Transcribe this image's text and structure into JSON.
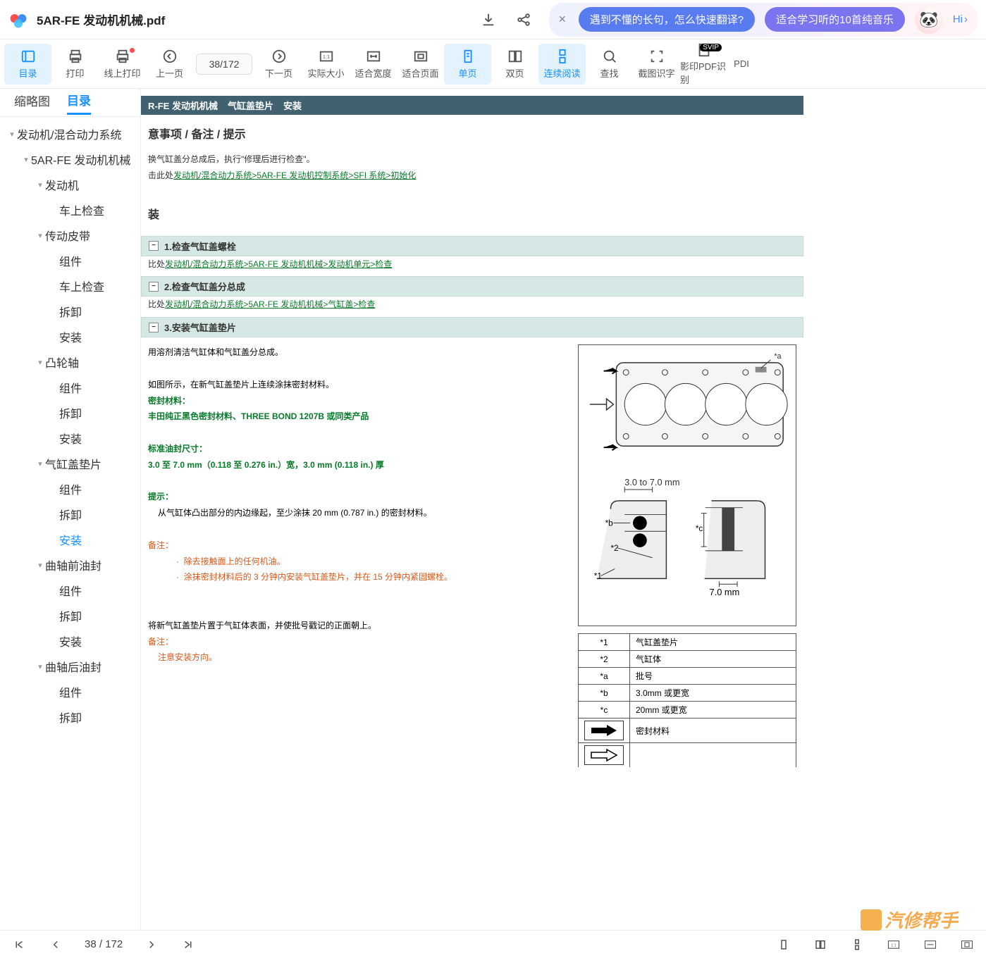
{
  "header": {
    "filename": "5AR-FE 发动机机械.pdf",
    "promo1": "遇到不懂的长句，怎么快速翻译?",
    "promo2": "适合学习听的10首纯音乐",
    "hi": "Hi"
  },
  "toolbar": {
    "mulu": "目录",
    "dayin": "打印",
    "xsdy": "线上打印",
    "prev": "上一页",
    "pagecur": "38",
    "pagesep": " / ",
    "pagetotal": "172",
    "next": "下一页",
    "sjdx": "实际大小",
    "shkd": "适合宽度",
    "shym": "适合页面",
    "dany": "单页",
    "shny": "双页",
    "lxyd": "连续阅读",
    "chazhao": "查找",
    "jtsz": "截图识字",
    "yypdf": "影印PDF识别",
    "pdl": "PDI",
    "svip": "SVIP"
  },
  "sideTabs": {
    "thumb": "缩略图",
    "toc": "目录"
  },
  "tree": [
    {
      "l": 0,
      "t": "发动机/混合动力系统",
      "arrow": true
    },
    {
      "l": 1,
      "t": "5AR-FE 发动机机械",
      "arrow": true
    },
    {
      "l": 2,
      "t": "发动机",
      "arrow": true
    },
    {
      "l": 3,
      "t": "车上检查"
    },
    {
      "l": 2,
      "t": "传动皮带",
      "arrow": true
    },
    {
      "l": 3,
      "t": "组件"
    },
    {
      "l": 3,
      "t": "车上检查"
    },
    {
      "l": 3,
      "t": "拆卸"
    },
    {
      "l": 3,
      "t": "安装"
    },
    {
      "l": 2,
      "t": "凸轮轴",
      "arrow": true
    },
    {
      "l": 3,
      "t": "组件"
    },
    {
      "l": 3,
      "t": "拆卸"
    },
    {
      "l": 3,
      "t": "安装"
    },
    {
      "l": 2,
      "t": "气缸盖垫片",
      "arrow": true
    },
    {
      "l": 3,
      "t": "组件"
    },
    {
      "l": 3,
      "t": "拆卸"
    },
    {
      "l": 3,
      "t": "安装",
      "sel": true
    },
    {
      "l": 2,
      "t": "曲轴前油封",
      "arrow": true
    },
    {
      "l": 3,
      "t": "组件"
    },
    {
      "l": 3,
      "t": "拆卸"
    },
    {
      "l": 3,
      "t": "安装"
    },
    {
      "l": 2,
      "t": "曲轴后油封",
      "arrow": true
    },
    {
      "l": 3,
      "t": "组件"
    },
    {
      "l": 3,
      "t": "拆卸"
    }
  ],
  "page": {
    "crumbs": [
      "R-FE 发动机机械",
      "气缸盖垫片",
      "安装"
    ],
    "title": "意事项 / 备注 / 提示",
    "intro1": "换气缸盖分总成后，执行\"修理后进行检查\"。",
    "intro2pre": "击此处",
    "intro2link": "发动机/混合动力系统>5AR-FE 发动机控制系统>SFI 系统>初始化",
    "zhuang": "装",
    "step1": "1.检查气缸盖螺栓",
    "link1pre": "比处",
    "link1": "发动机/混合动力系统>5AR-FE 发动机机械>发动机单元>检查",
    "step2": "2.检查气缸盖分总成",
    "link2pre": "比处",
    "link2": "发动机/混合动力系统>5AR-FE 发动机机械>气缸盖>检查",
    "step3": "3.安装气缸盖垫片",
    "p1": "用溶剂清洁气缸体和气缸盖分总成。",
    "p2": "如图所示，在新气缸盖垫片上连续涂抹密封材料。",
    "p3": "密封材料：",
    "p4": "丰田纯正黑色密封材料、THREE BOND 1207B 或同类产品",
    "p5": "标准油封尺寸：",
    "p6": "3.0 至 7.0 mm（0.118 至 0.276 in.）宽，3.0 mm (0.118 in.) 厚",
    "tishi": "提示：",
    "tishi1": "从气缸体凸出部分的内边缘起，至少涂抹 20 mm (0.787 in.) 的密封材料。",
    "beizhu": "备注：",
    "bz1": "除去接触面上的任何机油。",
    "bz2": "涂抹密封材料后的 3 分钟内安装气缸盖垫片，并在 15 分钟内紧固螺栓。",
    "p7": "将新气缸盖垫片置于气缸体表面，并使批号戳记的正面朝上。",
    "beizhu2": "备注：",
    "bz3": "注意安装方向。",
    "dim1": "3.0 to 7.0 mm",
    "dim2": "7.0 mm",
    "lbl_a": "*a",
    "lbl_b": "*b",
    "lbl_c": "*c",
    "lbl_1": "*1",
    "lbl_2": "*2",
    "legend": [
      [
        "*1",
        "气缸盖垫片"
      ],
      [
        "*2",
        "气缸体"
      ],
      [
        "*a",
        "批号"
      ],
      [
        "*b",
        "3.0mm 或更宽"
      ],
      [
        "*c",
        "20mm 或更宽"
      ]
    ],
    "legend_seal": "密封材料"
  },
  "bottom": {
    "page": "38",
    "sep": " / ",
    "total": "172"
  },
  "watermark": "汽修帮手"
}
